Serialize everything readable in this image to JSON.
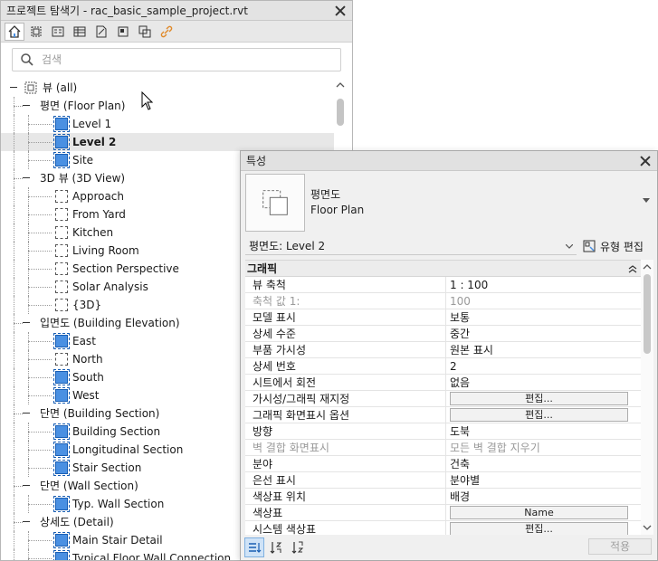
{
  "browser": {
    "title": "프로젝트 탐색기 - rac_basic_sample_project.rvt",
    "search_placeholder": "검색",
    "tree": [
      {
        "id": "views",
        "label": "뷰 (all)",
        "level": 0,
        "type": "root"
      },
      {
        "id": "fp",
        "label": "평면 (Floor Plan)",
        "level": 1,
        "type": "group"
      },
      {
        "id": "fp1",
        "label": "Level 1",
        "level": 2,
        "type": "plan"
      },
      {
        "id": "fp2",
        "label": "Level 2",
        "level": 2,
        "type": "plan",
        "selected": true
      },
      {
        "id": "fp3",
        "label": "Site",
        "level": 2,
        "type": "plan"
      },
      {
        "id": "d3",
        "label": "3D 뷰 (3D View)",
        "level": 1,
        "type": "group"
      },
      {
        "id": "d31",
        "label": "Approach",
        "level": 2,
        "type": "d3"
      },
      {
        "id": "d32",
        "label": "From Yard",
        "level": 2,
        "type": "d3"
      },
      {
        "id": "d33",
        "label": "Kitchen",
        "level": 2,
        "type": "d3"
      },
      {
        "id": "d34",
        "label": "Living Room",
        "level": 2,
        "type": "d3"
      },
      {
        "id": "d35",
        "label": "Section Perspective",
        "level": 2,
        "type": "d3"
      },
      {
        "id": "d36",
        "label": "Solar Analysis",
        "level": 2,
        "type": "d3"
      },
      {
        "id": "d37",
        "label": "{3D}",
        "level": 2,
        "type": "d3"
      },
      {
        "id": "el",
        "label": "입면도 (Building Elevation)",
        "level": 1,
        "type": "group"
      },
      {
        "id": "el1",
        "label": "East",
        "level": 2,
        "type": "plan"
      },
      {
        "id": "el2",
        "label": "North",
        "level": 2,
        "type": "d3"
      },
      {
        "id": "el3",
        "label": "South",
        "level": 2,
        "type": "plan"
      },
      {
        "id": "el4",
        "label": "West",
        "level": 2,
        "type": "plan"
      },
      {
        "id": "bs",
        "label": "단면 (Building Section)",
        "level": 1,
        "type": "group"
      },
      {
        "id": "bs1",
        "label": "Building Section",
        "level": 2,
        "type": "plan"
      },
      {
        "id": "bs2",
        "label": "Longitudinal Section",
        "level": 2,
        "type": "plan"
      },
      {
        "id": "bs3",
        "label": "Stair Section",
        "level": 2,
        "type": "plan"
      },
      {
        "id": "ws",
        "label": "단면 (Wall Section)",
        "level": 1,
        "type": "group"
      },
      {
        "id": "ws1",
        "label": "Typ. Wall Section",
        "level": 2,
        "type": "plan"
      },
      {
        "id": "dt",
        "label": "상세도 (Detail)",
        "level": 1,
        "type": "group"
      },
      {
        "id": "dt1",
        "label": "Main Stair Detail",
        "level": 2,
        "type": "plan"
      },
      {
        "id": "dt2",
        "label": "Typical Floor Wall Connection",
        "level": 2,
        "type": "plan"
      }
    ]
  },
  "properties": {
    "title": "특성",
    "type_name_ko": "평면도",
    "type_name_en": "Floor Plan",
    "instance_label": "평면도: Level 2",
    "edit_type_label": "유형 편집",
    "group": "그래픽",
    "rows": [
      {
        "name": "뷰 축척",
        "value": "1 : 100"
      },
      {
        "name": "축척 값    1:",
        "value": "100",
        "disabled": true
      },
      {
        "name": "모델 표시",
        "value": "보통"
      },
      {
        "name": "상세 수준",
        "value": "중간"
      },
      {
        "name": "부품 가시성",
        "value": "원본 표시"
      },
      {
        "name": "상세 번호",
        "value": "2"
      },
      {
        "name": "시트에서 회전",
        "value": "없음"
      },
      {
        "name": "가시성/그래픽 재지정",
        "value": "편집...",
        "button": true
      },
      {
        "name": "그래픽 화면표시 옵션",
        "value": "편집...",
        "button": true
      },
      {
        "name": "방향",
        "value": "도북"
      },
      {
        "name": "벽 결합 화면표시",
        "value": "모든 벽 결합 지우기",
        "disabled": true
      },
      {
        "name": "분야",
        "value": "건축"
      },
      {
        "name": "은선 표시",
        "value": "분야별"
      },
      {
        "name": "색상표 위치",
        "value": "배경"
      },
      {
        "name": "색상표",
        "value": "Name",
        "button": true
      },
      {
        "name": "시스템 색상표",
        "value": "편집...",
        "button": true
      }
    ],
    "apply_label": "적용"
  }
}
